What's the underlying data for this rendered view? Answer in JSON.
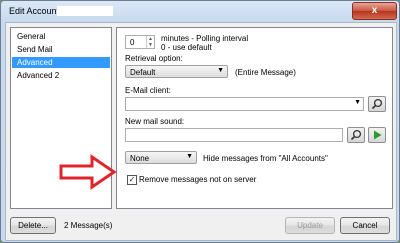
{
  "window": {
    "title": "Edit Account:",
    "close_label": "x"
  },
  "sidebar": {
    "items": [
      {
        "label": "General"
      },
      {
        "label": "Send Mail"
      },
      {
        "label": "Advanced"
      },
      {
        "label": "Advanced 2"
      }
    ],
    "selected": "Advanced"
  },
  "advanced": {
    "polling_interval_value": "0",
    "polling_line1": "minutes - Polling interval",
    "polling_line2": "0 - use default",
    "retrieval_label": "Retrieval option:",
    "retrieval_value": "Default",
    "retrieval_note": "(Entire Message)",
    "email_client_label": "E-Mail client:",
    "email_client_value": "",
    "new_mail_sound_label": "New mail sound:",
    "new_mail_sound_value": "",
    "hide_select_value": "None",
    "hide_label": "Hide messages from \"All Accounts\"",
    "remove_messages_label": "Remove messages not on server",
    "remove_messages_checked": true
  },
  "footer": {
    "delete_label": "Delete...",
    "message_count": "2 Message(s)",
    "update_label": "Update",
    "cancel_label": "Cancel"
  },
  "colors": {
    "selection": "#3399ff",
    "annotation_arrow": "#e0262c",
    "play_icon": "#2e9a2e"
  }
}
